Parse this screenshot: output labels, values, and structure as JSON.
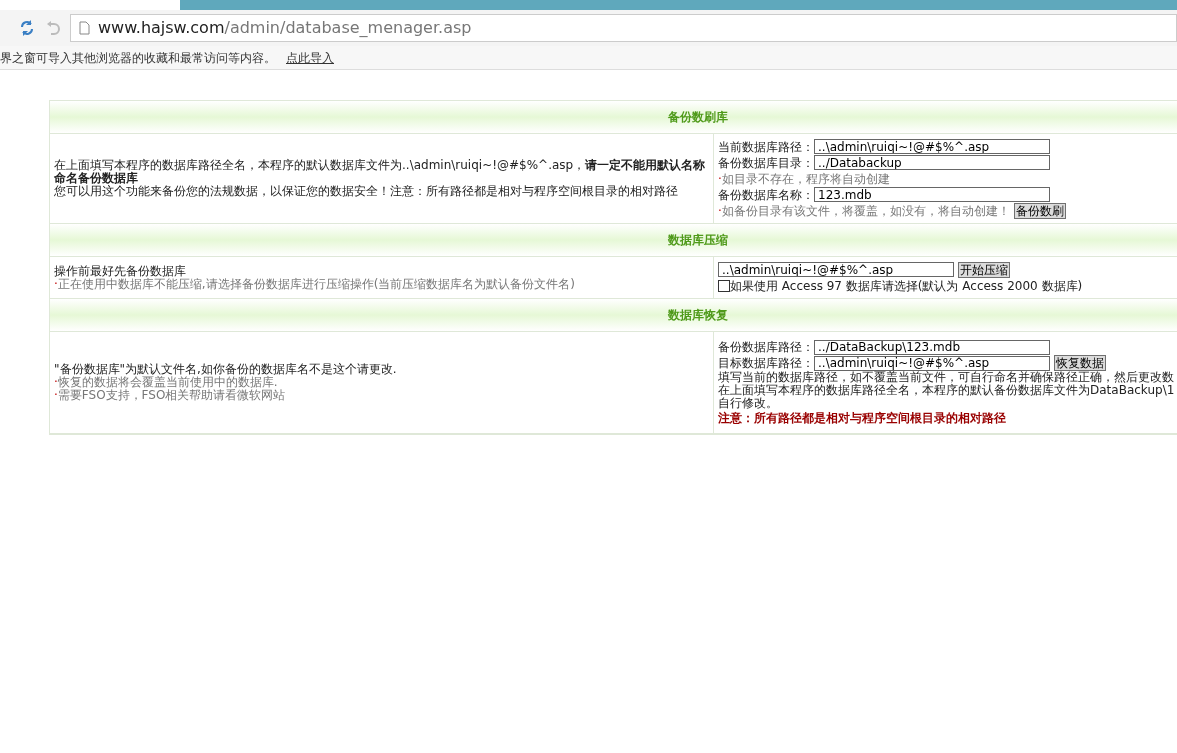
{
  "browser": {
    "url": {
      "host": "www.hajsw.com",
      "path": "/admin/database_menager.asp"
    },
    "infobar": {
      "text": "界之窗可导入其他浏览器的收藏和最常访问等内容。",
      "link": "点此导入"
    }
  },
  "sections": [
    {
      "title": "备份数刷库",
      "kind": "backup",
      "left": {
        "paragraphs": [
          "在上面填写本程序的数据库路径全名，本程序的默认数据库文件为..\\admin\\ruiqi~!@#$%^.asp，**请一定不能用默认名称命名备份数据库**",
          "您可以用这个功能来备份您的法规数据，以保证您的数据安全！注意：所有路径都是相对与程序空间根目录的相对路径"
        ]
      },
      "right": [
        {
          "kind": "field",
          "label": "当前数据库路径：",
          "value": "..\\admin\\ruiqi~!@#$%^.asp"
        },
        {
          "kind": "field",
          "label": "备份数据库目录：",
          "value": "../Databackup"
        },
        {
          "kind": "note",
          "bullet": "·",
          "text": "如目录不存在，程序将自动创建"
        },
        {
          "kind": "field",
          "label": "备份数据库名称：",
          "value": "123.mdb"
        },
        {
          "kind": "note",
          "bullet": "·",
          "text": "如备份目录有该文件，将覆盖，如没有，将自动创建！",
          "button": "备份数刷"
        }
      ]
    },
    {
      "title": "数据库压缩",
      "kind": "compact",
      "left": {
        "paragraphs": [
          "操作前最好先备份数据库"
        ],
        "notes": [
          {
            "bullet": "·",
            "text": "正在使用中数据库不能压缩,请选择备份数据库进行压缩操作(当前压缩数据库名为默认备份文件名)"
          }
        ]
      },
      "right": [
        {
          "kind": "field",
          "value": "..\\admin\\ruiqi~!@#$%^.asp",
          "button": "开始压缩"
        },
        {
          "kind": "checkbox",
          "checked": false,
          "label": "如果使用 Access 97 数据库请选择(默认为 Access 2000 数据库)"
        }
      ]
    },
    {
      "title": "数据库恢复",
      "kind": "restore",
      "left": {
        "paragraphs": [
          "\"备份数据库\"为默认文件名,如你备份的数据库名不是这个请更改."
        ],
        "notes": [
          {
            "bullet": "·",
            "text": "恢复的数据将会覆盖当前使用中的数据库."
          },
          {
            "bullet": "·",
            "text": "需要FSO支持，FSO相关帮助请看微软网站"
          }
        ]
      },
      "right": [
        {
          "kind": "field",
          "label": "备份数据库路径：",
          "value": "../DataBackup\\123.mdb"
        },
        {
          "kind": "field",
          "label": "目标数据库路径：",
          "value": "..\\admin\\ruiqi~!@#$%^.asp",
          "button": "恢复数据"
        },
        {
          "kind": "text",
          "text": "填写当前的数据库路径，如不覆盖当前文件，可自行命名并确保路径正确，然后更改数"
        },
        {
          "kind": "text",
          "text": "在上面填写本程序的数据库路径全名，本程序的默认备份数据库文件为DataBackup\\1"
        },
        {
          "kind": "text",
          "text": "自行修改。"
        },
        {
          "kind": "warning",
          "text": "注意：所有路径都是相对与程序空间根目录的相对路径"
        }
      ]
    }
  ]
}
